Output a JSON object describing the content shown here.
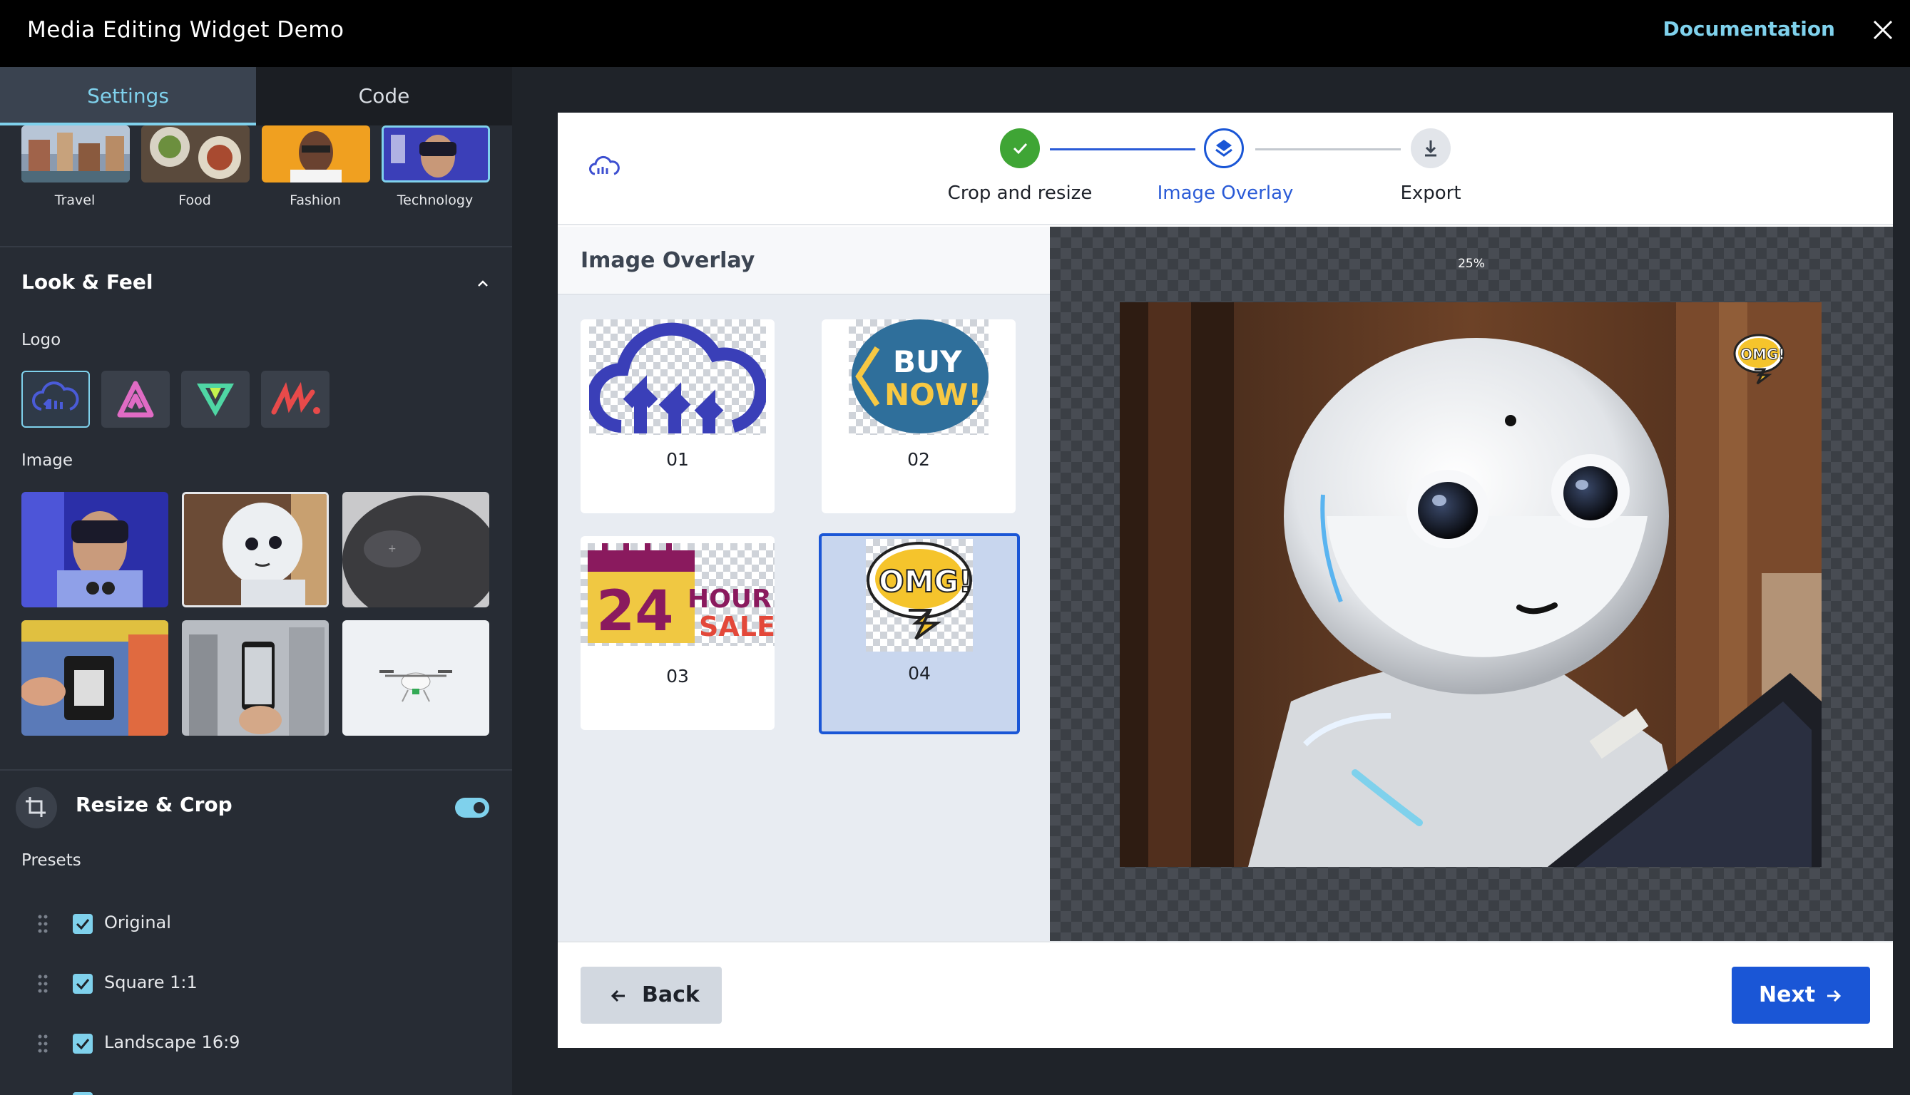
{
  "app": {
    "title": "Media Editing Widget Demo",
    "documentation_link": "Documentation",
    "close_icon": "close-icon"
  },
  "left_panel": {
    "tabs": [
      {
        "label": "Settings",
        "active": true
      },
      {
        "label": "Code",
        "active": false
      }
    ],
    "categories": [
      {
        "label": "Travel"
      },
      {
        "label": "Food"
      },
      {
        "label": "Fashion"
      },
      {
        "label": "Technology",
        "selected": true
      }
    ],
    "look_and_feel": {
      "title": "Look & Feel",
      "expanded": true,
      "logo_label": "Logo",
      "logos": [
        "cloud-logo-icon",
        "a-logo-icon",
        "v-logo-icon",
        "m-logo-icon"
      ],
      "selected_logo": "cloud-logo-icon",
      "image_label": "Image",
      "images": [
        "vr-headset-photo",
        "robot-photo",
        "speaker-photo",
        "shopping-photo",
        "phone-city-photo",
        "drone-photo"
      ],
      "selected_image": "robot-photo"
    },
    "resize_crop": {
      "title": "Resize & Crop",
      "enabled": true,
      "presets_label": "Presets",
      "presets": [
        {
          "label": "Original",
          "checked": true
        },
        {
          "label": "Square 1:1",
          "checked": true
        },
        {
          "label": "Landscape 16:9",
          "checked": true
        }
      ]
    }
  },
  "widget": {
    "steps": [
      {
        "label": "Crop and resize",
        "state": "done"
      },
      {
        "label": "Image Overlay",
        "state": "active"
      },
      {
        "label": "Export",
        "state": "pending"
      }
    ],
    "overlay_panel": {
      "title": "Image Overlay",
      "items": [
        {
          "label": "01",
          "selected": false
        },
        {
          "label": "02",
          "selected": false,
          "art_text": [
            "BUY",
            "NOW!"
          ]
        },
        {
          "label": "03",
          "selected": false,
          "art_text": [
            "24",
            "HOUR",
            "SALE"
          ]
        },
        {
          "label": "04",
          "selected": true,
          "art_text": [
            "OMG!"
          ]
        }
      ]
    },
    "preview": {
      "zoom": "25%",
      "overlay_badge": "OMG!"
    },
    "footer": {
      "back_label": "Back",
      "next_label": "Next"
    }
  },
  "colors": {
    "accent": "#7fd1ec",
    "primary": "#1a56d6",
    "success": "#3fa535",
    "panel_bg": "#272c34"
  }
}
